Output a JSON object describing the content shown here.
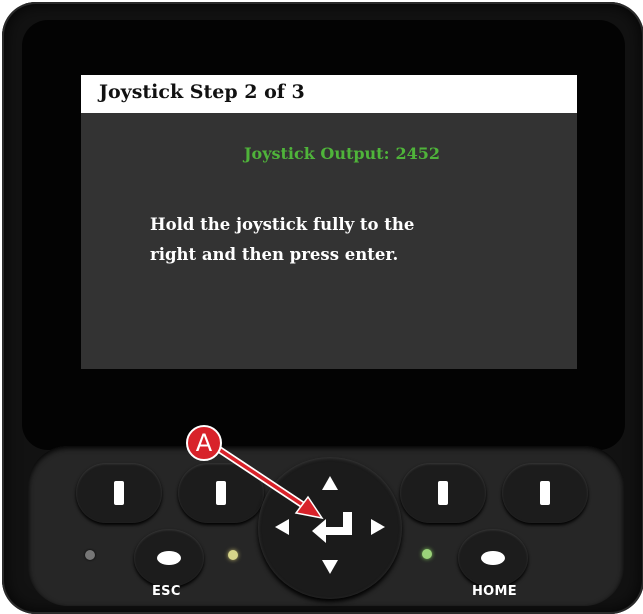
{
  "screen": {
    "title": "Joystick Step 2 of 3",
    "output_label": "Joystick Output:",
    "output_value": "2452",
    "instruction_line1": "Hold the joystick fully to the",
    "instruction_line2": "right and then press enter."
  },
  "keypad": {
    "esc_label": "ESC",
    "home_label": "HOME"
  },
  "callout": {
    "label": "A"
  },
  "colors": {
    "output_text": "#4fb43a",
    "callout": "#d8222a",
    "screen_bg": "#333333"
  },
  "icons": [
    "softkey-mark-icon",
    "arrow-up-icon",
    "arrow-down-icon",
    "arrow-left-icon",
    "arrow-right-icon",
    "enter-icon",
    "callout-arrow-icon"
  ]
}
